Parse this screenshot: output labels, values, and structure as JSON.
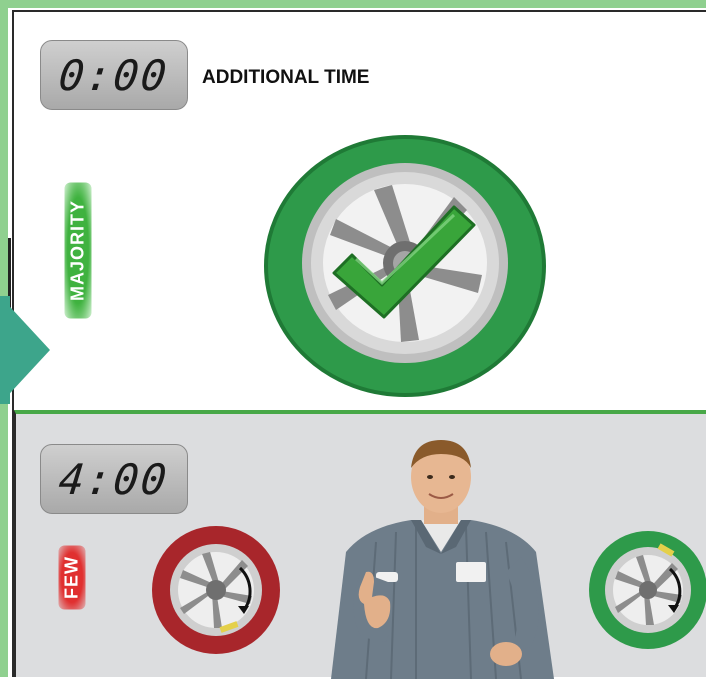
{
  "majority_panel": {
    "timer": "0:00",
    "caption": "ADDITIONAL TIME",
    "label": "MAJORITY"
  },
  "few_panel": {
    "timer": "4:00",
    "label": "FEW"
  },
  "colors": {
    "frame_green": "#8fd08f",
    "arrow_teal": "#3da58b",
    "tire_green": "#2e9a4a",
    "tire_red": "#a8262b",
    "check_green": "#3fb23f",
    "panel_gray": "#dcdddf"
  },
  "icons": [
    "checkmark-icon",
    "wheel-icon",
    "arrow-icon"
  ]
}
